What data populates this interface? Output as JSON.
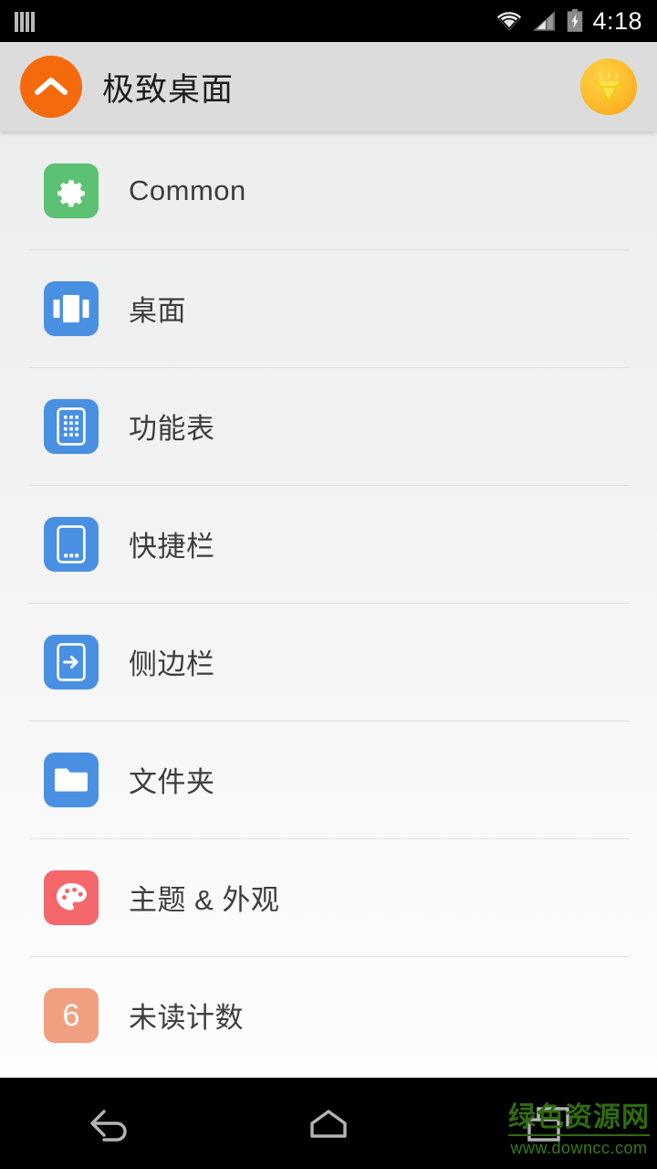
{
  "status_bar": {
    "time": "4:18",
    "left_icon": "sim-card-bars-icon",
    "icons": [
      "wifi-icon",
      "cellular-signal-icon",
      "battery-charging-icon"
    ],
    "background_color": "#000000",
    "text_color": "#ffffff"
  },
  "header": {
    "title": "极致桌面",
    "up_button_icon": "chevron-up-icon",
    "up_button_color": "#f56a0c",
    "badge_icon": "diamond-gem-icon",
    "badge_color": "#ffc02e",
    "background_color": "#dcdcdc"
  },
  "list": {
    "items": [
      {
        "label": "Common",
        "icon": "gear-icon",
        "icon_color": "#5cc172"
      },
      {
        "label": "桌面",
        "icon": "carousel-icon",
        "icon_color": "#4a90e2"
      },
      {
        "label": "功能表",
        "icon": "app-drawer-icon",
        "icon_color": "#4a90e2"
      },
      {
        "label": "快捷栏",
        "icon": "dock-phone-icon",
        "icon_color": "#4a90e2"
      },
      {
        "label": "侧边栏",
        "icon": "sidebar-arrow-icon",
        "icon_color": "#4a90e2"
      },
      {
        "label": "文件夹",
        "icon": "folder-icon",
        "icon_color": "#4a90e2"
      },
      {
        "label": "主题 & 外观",
        "icon": "palette-icon",
        "icon_color": "#f4676b"
      },
      {
        "label": "未读计数",
        "icon": "unread-count-icon",
        "icon_color": "#f0a080",
        "badge_value": "6"
      }
    ]
  },
  "nav_bar": {
    "buttons": [
      "back-icon",
      "home-icon",
      "recents-icon"
    ],
    "background_color": "#000000"
  },
  "watermark": {
    "main": "绿色资源网",
    "sub": "www.downcc.com",
    "color": "#2f6b12"
  }
}
